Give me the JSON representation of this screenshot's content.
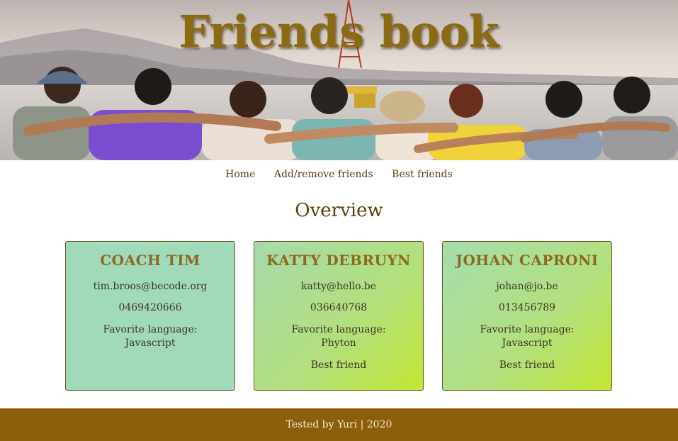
{
  "header": {
    "title": "Friends book"
  },
  "nav": {
    "items": [
      {
        "label": "Home"
      },
      {
        "label": "Add/remove friends"
      },
      {
        "label": "Best friends"
      }
    ]
  },
  "main": {
    "heading": "Overview",
    "cards": [
      {
        "name": "COACH TIM",
        "email": "tim.broos@becode.org",
        "phone": "0469420666",
        "language_label": "Favorite language:",
        "language": "Javascript",
        "badge": ""
      },
      {
        "name": "KATTY DEBRUYN",
        "email": "katty@hello.be",
        "phone": "036640768",
        "language_label": "Favorite language:",
        "language": "Phyton",
        "badge": "Best friend"
      },
      {
        "name": "JOHAN CAPRONI",
        "email": "johan@jo.be",
        "phone": "013456789",
        "language_label": "Favorite language:",
        "language": "Javascript",
        "badge": "Best friend"
      }
    ]
  },
  "footer": {
    "text": "Tested by Yuri | 2020"
  },
  "colors": {
    "accent": "#8b6a14",
    "footer_bg": "#8b5e0c",
    "card_teal": "#a0dabb",
    "card_lime": "#c2e632"
  }
}
